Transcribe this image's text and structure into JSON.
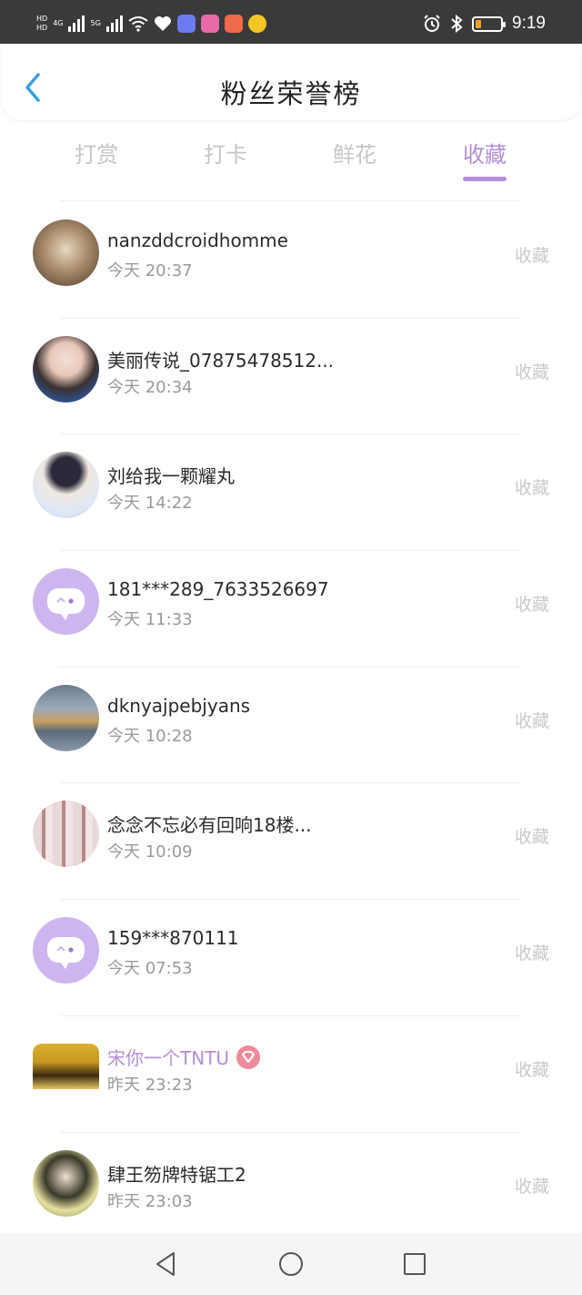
{
  "status_bar": {
    "hd1": "HD",
    "hd2": "HD",
    "net1": "4G",
    "net2": "5G",
    "time": "9:19",
    "battery_color": "#f0a020"
  },
  "header": {
    "title": "粉丝荣誉榜",
    "back_icon": "chevron-left-icon"
  },
  "tabs": [
    {
      "label": "打赏",
      "active": false
    },
    {
      "label": "打卡",
      "active": false
    },
    {
      "label": "鲜花",
      "active": false
    },
    {
      "label": "收藏",
      "active": true
    }
  ],
  "accent_color": "#b48fd8",
  "fans": [
    {
      "name": "nanzddcroidhomme",
      "time": "今天 20:37",
      "action": "收藏",
      "avatar": "photo-room"
    },
    {
      "name": "美丽传说_07875478512...",
      "time": "今天 20:34",
      "action": "收藏",
      "avatar": "photo-woman"
    },
    {
      "name": "刘给我一颗耀丸",
      "time": "今天 14:22",
      "action": "收藏",
      "avatar": "photo-boy"
    },
    {
      "name": "181***289_7633526697",
      "time": "今天 11:33",
      "action": "收藏",
      "avatar": "default-chat"
    },
    {
      "name": "dknyajpebjyans",
      "time": "今天 10:28",
      "action": "收藏",
      "avatar": "photo-landscape"
    },
    {
      "name": "念念不忘必有回响18楼...",
      "time": "今天 10:09",
      "action": "收藏",
      "avatar": "photo-group"
    },
    {
      "name": "159***870111",
      "time": "今天 07:53",
      "action": "收藏",
      "avatar": "default-chat"
    },
    {
      "name": "宋你一个TNTU",
      "time": "昨天 23:23",
      "action": "收藏",
      "avatar": "photo-stage",
      "vip": true
    },
    {
      "name": "肆王笏牌特锯工2",
      "time": "昨天 23:03",
      "action": "收藏",
      "avatar": "photo-flowers"
    }
  ],
  "nav": [
    "back-triangle-icon",
    "home-circle-icon",
    "recents-square-icon"
  ]
}
